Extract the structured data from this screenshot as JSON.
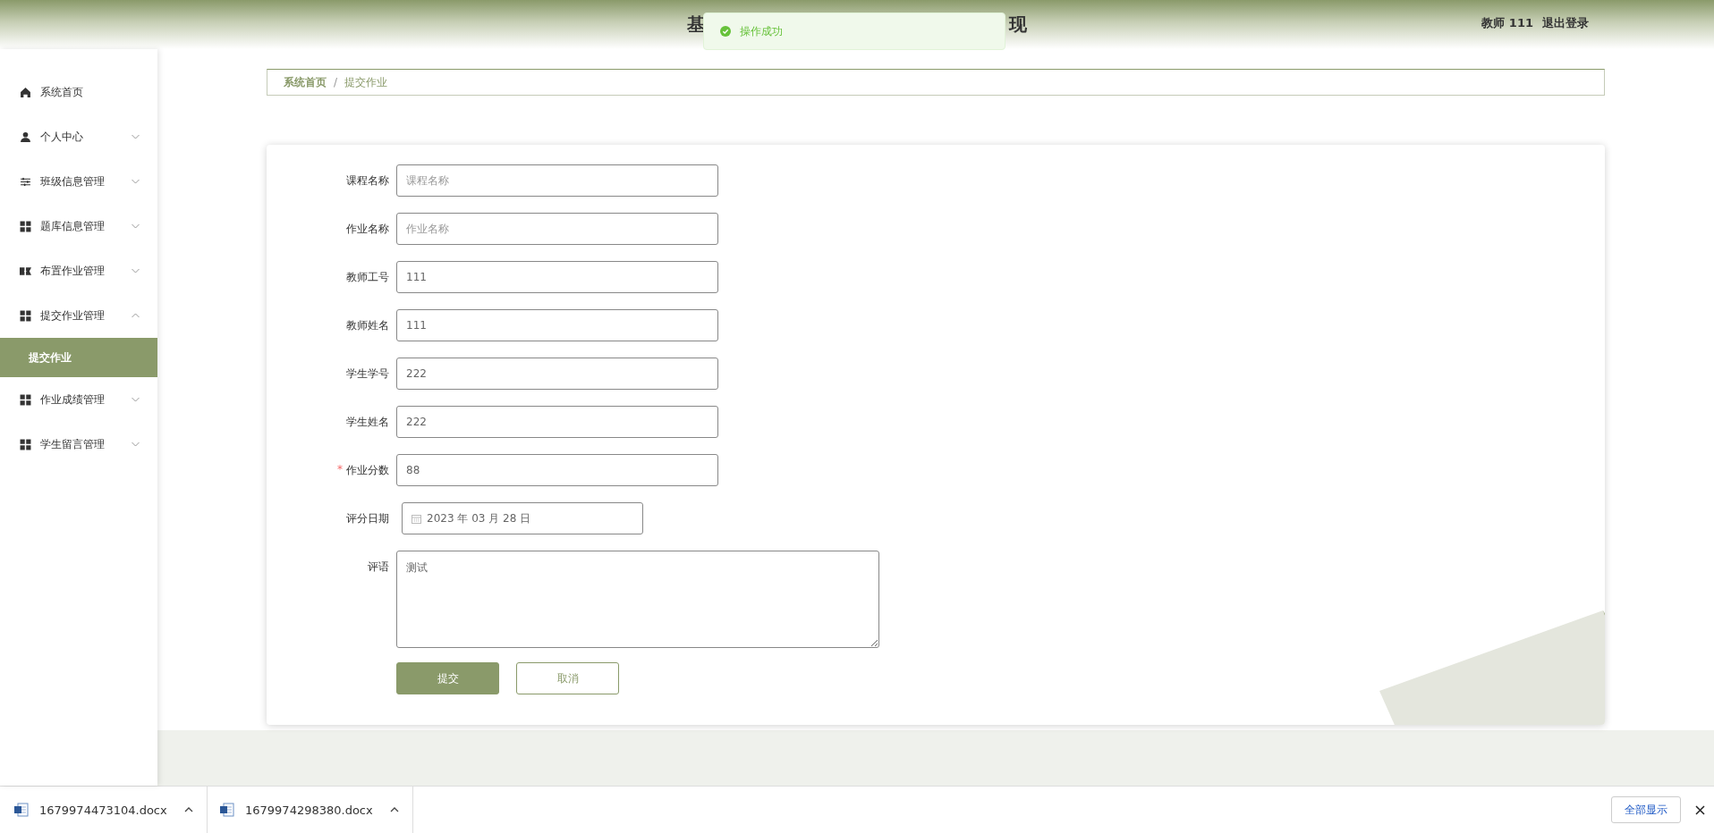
{
  "header": {
    "title_parts": [
      "基",
      "现"
    ],
    "user": "教师 111",
    "logout": "退出登录"
  },
  "toast": {
    "message": "操作成功"
  },
  "sidebar": {
    "items": [
      {
        "label": "系统首页"
      },
      {
        "label": "个人中心",
        "expanded": false
      },
      {
        "label": "班级信息管理",
        "expanded": false
      },
      {
        "label": "题库信息管理",
        "expanded": false
      },
      {
        "label": "布置作业管理",
        "expanded": false
      },
      {
        "label": "提交作业管理",
        "expanded": true,
        "children": [
          {
            "label": "提交作业",
            "selected": true
          }
        ]
      },
      {
        "label": "作业成绩管理",
        "expanded": false
      },
      {
        "label": "学生留言管理",
        "expanded": false
      }
    ]
  },
  "breadcrumb": {
    "items": [
      "系统首页",
      "提交作业"
    ],
    "separator": "/"
  },
  "form": {
    "required_mark": "*",
    "fields": [
      {
        "kind": "text",
        "label": "课程名称",
        "placeholder": "课程名称",
        "required": false
      },
      {
        "kind": "text",
        "label": "作业名称",
        "placeholder": "作业名称",
        "required": false
      },
      {
        "kind": "text",
        "label": "教师工号",
        "value": "111",
        "required": false
      },
      {
        "kind": "text",
        "label": "教师姓名",
        "value": "111",
        "required": false
      },
      {
        "kind": "text",
        "label": "学生学号",
        "value": "222",
        "required": false
      },
      {
        "kind": "text",
        "label": "学生姓名",
        "value": "222",
        "required": false
      },
      {
        "kind": "text",
        "label": "作业分数",
        "value": "88",
        "required": true
      },
      {
        "kind": "date",
        "label": "评分日期",
        "value": "2023 年 03 月 28 日",
        "required": false
      },
      {
        "kind": "textarea",
        "label": "评语",
        "value": "测试",
        "required": false
      }
    ],
    "submit": "提交",
    "cancel": "取消"
  },
  "downloads": {
    "files": [
      "1679974473104.docx",
      "1679974298380.docx"
    ],
    "show_all": "全部显示"
  }
}
